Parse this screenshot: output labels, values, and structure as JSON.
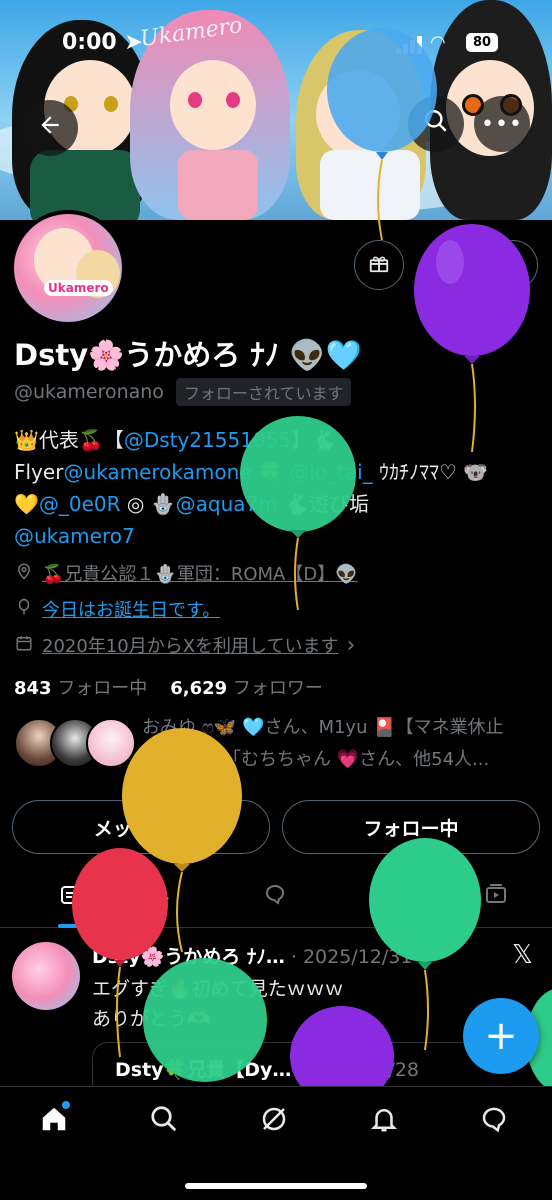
{
  "status_bar": {
    "time": "0:00",
    "battery": "80"
  },
  "banner": {
    "tag": "Ukamero"
  },
  "profile": {
    "name": "Dsty🌸うかめろ ﾅﾉ 👽🩵",
    "handle": "@ukameronano",
    "follows_you": "フォローされています",
    "avatar_logo": "Ukamero"
  },
  "bio": {
    "line1_prefix": "👑代表🍒【",
    "line1_link": "@Dsty21551055",
    "line1_suffix": "】🐇",
    "line2_prefix": "Flyer",
    "line2_link1": "@ukamerokamone",
    "line2_mid": " 🍀 ",
    "line2_link2": "@io_tai_",
    "line2_suffix": " ｳｶﾁﾉﾏﾏ♡ 🐨",
    "line3_prefix": "💛",
    "line3_link1": "@_0e0R",
    "line3_mid": " ◎ 🪬",
    "line3_link2": "@aqua7m",
    "line3_suffix": " 🐇遊び垢",
    "line4_link": "@ukamero7"
  },
  "meta": {
    "location": "🍒兄貴公認１🪬軍団：ROMA【D】👽",
    "birthday": "今日はお誕生日です。",
    "joined": "2020年10月からXを利用しています",
    "joined_chevron": "›"
  },
  "counts": {
    "following_num": "843",
    "following_label": "フォロー中",
    "followers_num": "6,629",
    "followers_label": "フォロワー"
  },
  "mutuals": {
    "line1": "おみゆ ෆ🦋 🩵さん、M1yu 🎴【マネ業休止",
    "line2": "中】さん、「むちちゃん 💗さん、他54人..."
  },
  "actions": {
    "message": "メッセージ",
    "following": "フォロー中"
  },
  "tabs": {
    "posts": "ポスト"
  },
  "post": {
    "author": "Dsty🌸うかめろ ﾅﾉ…",
    "date": "· 2025/12/31",
    "text_line1": "エグすぎ🔥初めて見たｗｗｗ",
    "text_line2": "ありがとう🫶",
    "quote_author": "Dsty🍀兄貴【Dy…",
    "quote_date": "· 2025/12/28"
  },
  "icons": {
    "back": "back-arrow-icon",
    "search": "search-icon",
    "more": "more-icon",
    "gift": "gift-icon",
    "notify": "bell-icon",
    "share": "share-icon",
    "compose": "plus-icon"
  },
  "colors": {
    "accent": "#1d9bf0",
    "background": "#000000",
    "text_secondary": "#71767b",
    "balloon_blue": "#4aa8f0",
    "balloon_purple": "#8a2be2",
    "balloon_green": "#2ecc8a",
    "balloon_yellow": "#e2b12c",
    "balloon_red": "#e8334d"
  }
}
